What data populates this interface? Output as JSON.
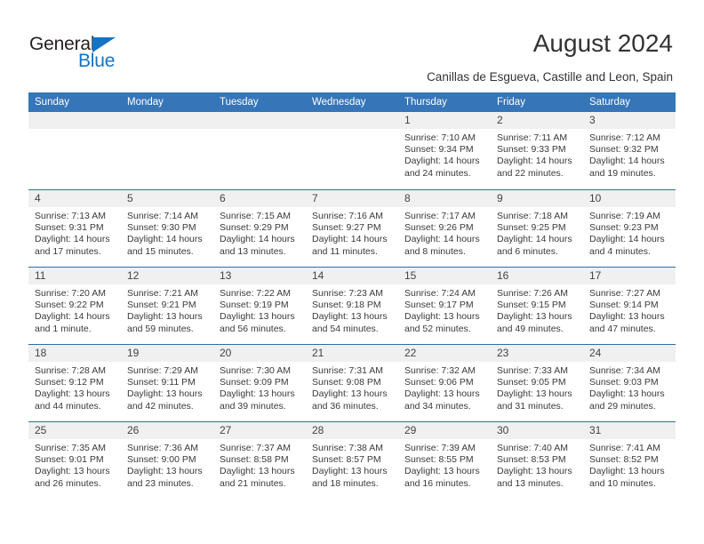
{
  "brand": {
    "word_one": "General",
    "word_two": "Blue",
    "triangle_color": "#1473c4",
    "text_color": "#231f20"
  },
  "header": {
    "title": "August 2024",
    "subtitle": "Canillas de Esgueva, Castille and Leon, Spain"
  },
  "colors": {
    "header_blue": "#3575b8",
    "row_divider": "#2f6ca8",
    "daynum_band": "#f0f0f0",
    "body_text": "#333333"
  },
  "calendar": {
    "weekday_headers": [
      "Sunday",
      "Monday",
      "Tuesday",
      "Wednesday",
      "Thursday",
      "Friday",
      "Saturday"
    ],
    "weeks": [
      [
        {
          "day": "",
          "empty": true
        },
        {
          "day": "",
          "empty": true
        },
        {
          "day": "",
          "empty": true
        },
        {
          "day": "",
          "empty": true
        },
        {
          "day": "1",
          "sunrise": "Sunrise: 7:10 AM",
          "sunset": "Sunset: 9:34 PM",
          "daylight": "Daylight: 14 hours and 24 minutes."
        },
        {
          "day": "2",
          "sunrise": "Sunrise: 7:11 AM",
          "sunset": "Sunset: 9:33 PM",
          "daylight": "Daylight: 14 hours and 22 minutes."
        },
        {
          "day": "3",
          "sunrise": "Sunrise: 7:12 AM",
          "sunset": "Sunset: 9:32 PM",
          "daylight": "Daylight: 14 hours and 19 minutes."
        }
      ],
      [
        {
          "day": "4",
          "sunrise": "Sunrise: 7:13 AM",
          "sunset": "Sunset: 9:31 PM",
          "daylight": "Daylight: 14 hours and 17 minutes."
        },
        {
          "day": "5",
          "sunrise": "Sunrise: 7:14 AM",
          "sunset": "Sunset: 9:30 PM",
          "daylight": "Daylight: 14 hours and 15 minutes."
        },
        {
          "day": "6",
          "sunrise": "Sunrise: 7:15 AM",
          "sunset": "Sunset: 9:29 PM",
          "daylight": "Daylight: 14 hours and 13 minutes."
        },
        {
          "day": "7",
          "sunrise": "Sunrise: 7:16 AM",
          "sunset": "Sunset: 9:27 PM",
          "daylight": "Daylight: 14 hours and 11 minutes."
        },
        {
          "day": "8",
          "sunrise": "Sunrise: 7:17 AM",
          "sunset": "Sunset: 9:26 PM",
          "daylight": "Daylight: 14 hours and 8 minutes."
        },
        {
          "day": "9",
          "sunrise": "Sunrise: 7:18 AM",
          "sunset": "Sunset: 9:25 PM",
          "daylight": "Daylight: 14 hours and 6 minutes."
        },
        {
          "day": "10",
          "sunrise": "Sunrise: 7:19 AM",
          "sunset": "Sunset: 9:23 PM",
          "daylight": "Daylight: 14 hours and 4 minutes."
        }
      ],
      [
        {
          "day": "11",
          "sunrise": "Sunrise: 7:20 AM",
          "sunset": "Sunset: 9:22 PM",
          "daylight": "Daylight: 14 hours and 1 minute."
        },
        {
          "day": "12",
          "sunrise": "Sunrise: 7:21 AM",
          "sunset": "Sunset: 9:21 PM",
          "daylight": "Daylight: 13 hours and 59 minutes."
        },
        {
          "day": "13",
          "sunrise": "Sunrise: 7:22 AM",
          "sunset": "Sunset: 9:19 PM",
          "daylight": "Daylight: 13 hours and 56 minutes."
        },
        {
          "day": "14",
          "sunrise": "Sunrise: 7:23 AM",
          "sunset": "Sunset: 9:18 PM",
          "daylight": "Daylight: 13 hours and 54 minutes."
        },
        {
          "day": "15",
          "sunrise": "Sunrise: 7:24 AM",
          "sunset": "Sunset: 9:17 PM",
          "daylight": "Daylight: 13 hours and 52 minutes."
        },
        {
          "day": "16",
          "sunrise": "Sunrise: 7:26 AM",
          "sunset": "Sunset: 9:15 PM",
          "daylight": "Daylight: 13 hours and 49 minutes."
        },
        {
          "day": "17",
          "sunrise": "Sunrise: 7:27 AM",
          "sunset": "Sunset: 9:14 PM",
          "daylight": "Daylight: 13 hours and 47 minutes."
        }
      ],
      [
        {
          "day": "18",
          "sunrise": "Sunrise: 7:28 AM",
          "sunset": "Sunset: 9:12 PM",
          "daylight": "Daylight: 13 hours and 44 minutes."
        },
        {
          "day": "19",
          "sunrise": "Sunrise: 7:29 AM",
          "sunset": "Sunset: 9:11 PM",
          "daylight": "Daylight: 13 hours and 42 minutes."
        },
        {
          "day": "20",
          "sunrise": "Sunrise: 7:30 AM",
          "sunset": "Sunset: 9:09 PM",
          "daylight": "Daylight: 13 hours and 39 minutes."
        },
        {
          "day": "21",
          "sunrise": "Sunrise: 7:31 AM",
          "sunset": "Sunset: 9:08 PM",
          "daylight": "Daylight: 13 hours and 36 minutes."
        },
        {
          "day": "22",
          "sunrise": "Sunrise: 7:32 AM",
          "sunset": "Sunset: 9:06 PM",
          "daylight": "Daylight: 13 hours and 34 minutes."
        },
        {
          "day": "23",
          "sunrise": "Sunrise: 7:33 AM",
          "sunset": "Sunset: 9:05 PM",
          "daylight": "Daylight: 13 hours and 31 minutes."
        },
        {
          "day": "24",
          "sunrise": "Sunrise: 7:34 AM",
          "sunset": "Sunset: 9:03 PM",
          "daylight": "Daylight: 13 hours and 29 minutes."
        }
      ],
      [
        {
          "day": "25",
          "sunrise": "Sunrise: 7:35 AM",
          "sunset": "Sunset: 9:01 PM",
          "daylight": "Daylight: 13 hours and 26 minutes."
        },
        {
          "day": "26",
          "sunrise": "Sunrise: 7:36 AM",
          "sunset": "Sunset: 9:00 PM",
          "daylight": "Daylight: 13 hours and 23 minutes."
        },
        {
          "day": "27",
          "sunrise": "Sunrise: 7:37 AM",
          "sunset": "Sunset: 8:58 PM",
          "daylight": "Daylight: 13 hours and 21 minutes."
        },
        {
          "day": "28",
          "sunrise": "Sunrise: 7:38 AM",
          "sunset": "Sunset: 8:57 PM",
          "daylight": "Daylight: 13 hours and 18 minutes."
        },
        {
          "day": "29",
          "sunrise": "Sunrise: 7:39 AM",
          "sunset": "Sunset: 8:55 PM",
          "daylight": "Daylight: 13 hours and 16 minutes."
        },
        {
          "day": "30",
          "sunrise": "Sunrise: 7:40 AM",
          "sunset": "Sunset: 8:53 PM",
          "daylight": "Daylight: 13 hours and 13 minutes."
        },
        {
          "day": "31",
          "sunrise": "Sunrise: 7:41 AM",
          "sunset": "Sunset: 8:52 PM",
          "daylight": "Daylight: 13 hours and 10 minutes."
        }
      ]
    ]
  }
}
